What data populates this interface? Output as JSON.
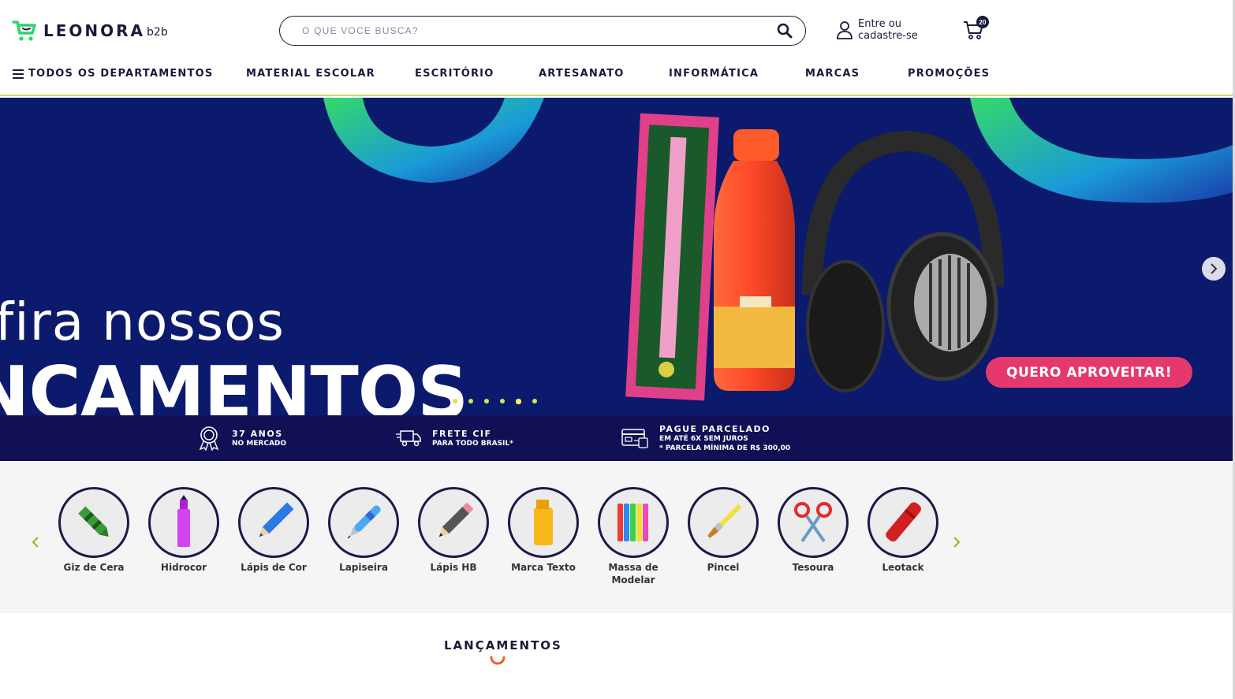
{
  "header": {
    "brand": "LEONORA",
    "brand_suffix": "b2b",
    "search_placeholder": "O QUE VOCE BUSCA?",
    "account_line1": "Entre ou",
    "account_line2": "cadastre-se",
    "cart_count": "20"
  },
  "nav": {
    "all_departments": "TODOS OS DEPARTAMENTOS",
    "items": [
      "MATERIAL ESCOLAR",
      "ESCRITÓRIO",
      "ARTESANATO",
      "INFORMÁTICA",
      "MARCAS",
      "PROMOÇÕES"
    ]
  },
  "banner": {
    "headline_line1": "fira nossos",
    "headline_line2": "NÇAMENTOS",
    "cta": "QUERO APROVEITAR!",
    "slides_total": 6,
    "active_slide": 5
  },
  "benefits": [
    {
      "title": "37 ANOS",
      "subtitle": "NO MERCADO",
      "icon": "award-icon"
    },
    {
      "title": "FRETE CIF",
      "subtitle": "PARA TODO BRASIL*",
      "icon": "truck-icon"
    },
    {
      "title": "PAGUE PARCELADO",
      "subtitle": "EM ATÉ 6X SEM JUROS",
      "subtitle2": "* PARCELA MÍNIMA DE R$ 300,00",
      "icon": "credit-card-icon"
    }
  ],
  "categories": [
    {
      "label": "Giz de Cera",
      "icon": "crayon-icon"
    },
    {
      "label": "Hidrocor",
      "icon": "marker-icon"
    },
    {
      "label": "Lápis de Cor",
      "icon": "colored-pencil-icon"
    },
    {
      "label": "Lapiseira",
      "icon": "mechanical-pencil-icon"
    },
    {
      "label": "Lápis HB",
      "icon": "pencil-icon"
    },
    {
      "label": "Marca Texto",
      "icon": "highlighter-icon"
    },
    {
      "label": "Massa de Modelar",
      "icon": "modeling-clay-icon"
    },
    {
      "label": "Pincel",
      "icon": "paintbrush-icon"
    },
    {
      "label": "Tesoura",
      "icon": "scissors-icon"
    },
    {
      "label": "Leotack",
      "icon": "glue-stick-icon"
    }
  ],
  "section": {
    "title": "LANÇAMENTOS"
  },
  "colors": {
    "brand_dark": "#1a1a3a",
    "brand_green": "#2fd36a",
    "banner_bg": "#0c1a6e",
    "benefits_bg": "#111055",
    "cta_pink": "#e5396e",
    "accent_lime": "#c9dd6b",
    "spinner_orange": "#e8622c"
  }
}
